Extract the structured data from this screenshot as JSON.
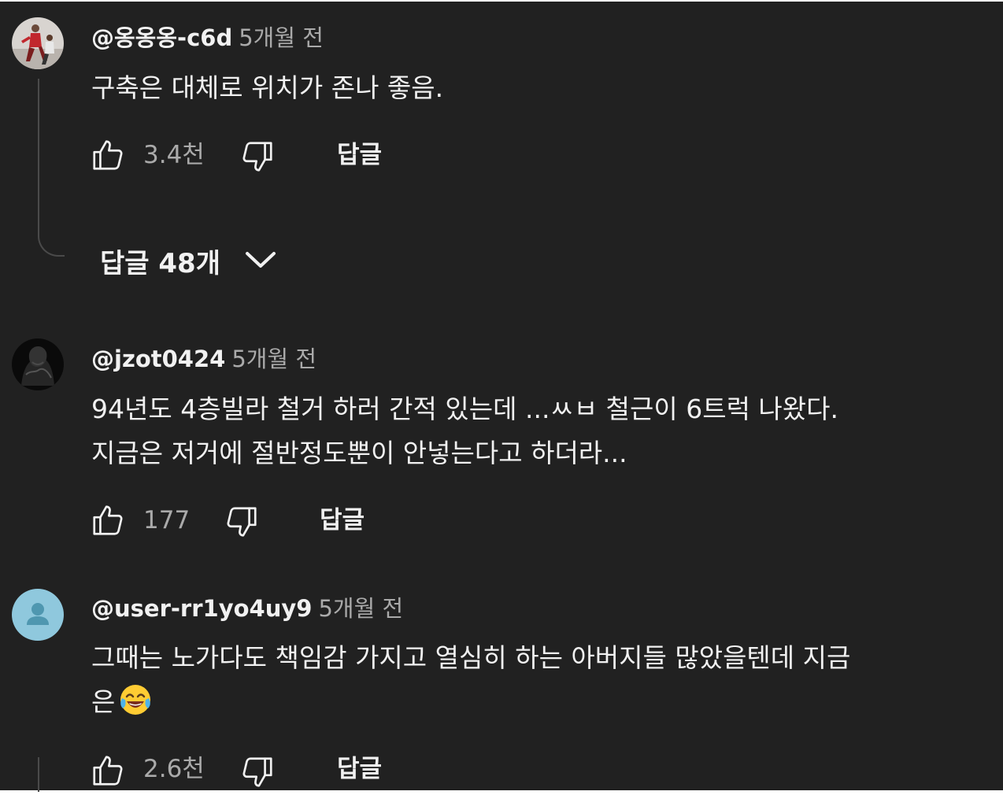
{
  "comments": [
    {
      "author": "@옹옹옹-c6d",
      "time": "5개월 전",
      "text": "구축은 대체로 위치가 존나 좋음.",
      "likes": "3.4천",
      "reply_label": "답글",
      "avatar": "photo-avatar"
    },
    {
      "author": "@jzot0424",
      "time": "5개월 전",
      "text_lines": [
        "94년도 4층빌라 철거 하러 간적 있는데 ...ㅆㅂ 철근이 6트럭 나왔다.",
        "지금은 저거에 절반정도뿐이 안넣는다고 하더라..."
      ],
      "likes": "177",
      "reply_label": "답글",
      "avatar": "dark-silhouette-avatar"
    },
    {
      "author": "@user-rr1yo4uy9",
      "time": "5개월 전",
      "text_lines": [
        "그때는 노가다도 책임감 가지고 열심히 하는 아버지들 많았을텐데 지금",
        "은"
      ],
      "emoji": "face-with-tears-of-joy",
      "likes": "2.6천",
      "reply_label": "답글",
      "avatar": "default-user-avatar"
    }
  ],
  "replies_toggle": {
    "label": "답글 48개",
    "icon": "chevron-down-icon"
  },
  "colors": {
    "background": "#212121",
    "text": "#f1f1f1",
    "secondary_text": "#aaaaaa",
    "thread_line": "#4a4a4a",
    "default_avatar_bg": "#8fc8dd"
  }
}
